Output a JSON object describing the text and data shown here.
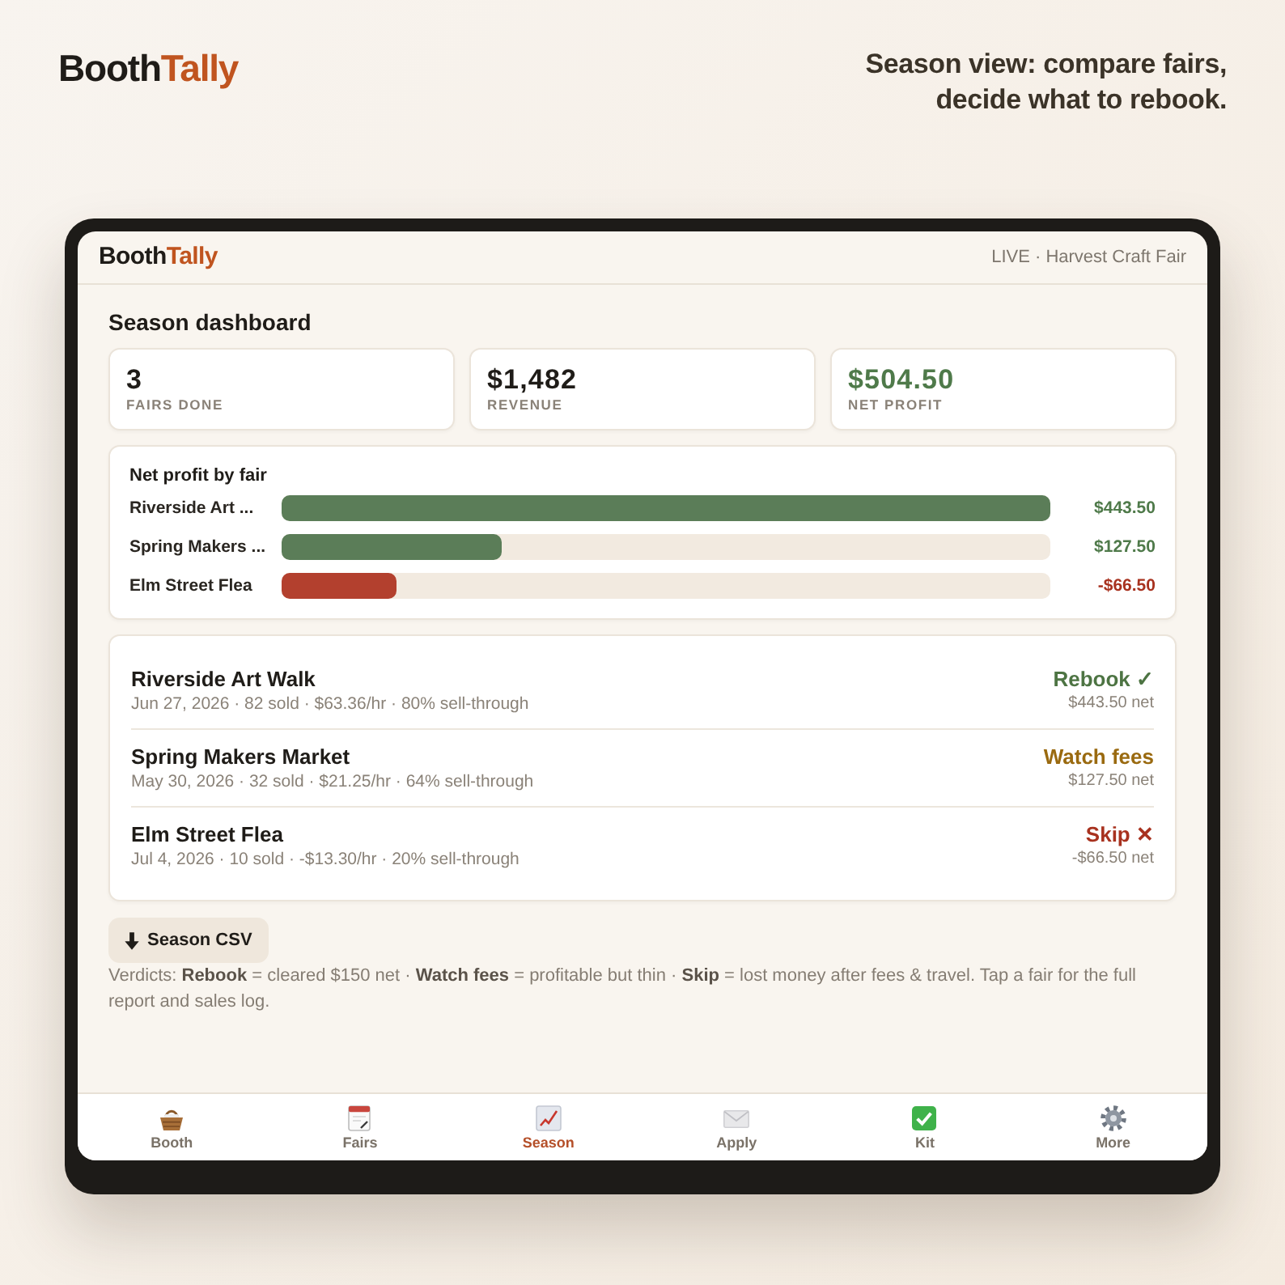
{
  "brand": {
    "name": "Booth",
    "accent": "Tally"
  },
  "tagline": [
    "Season view: compare fairs,",
    "decide what to rebook."
  ],
  "app_header": {
    "brand": {
      "name": "Booth",
      "accent": "Tally"
    },
    "status": "LIVE · Harvest Craft Fair"
  },
  "dashboard": {
    "title": "Season dashboard",
    "stats": [
      {
        "value": "3",
        "label": "FAIRS DONE",
        "kind": "neutral"
      },
      {
        "value": "$1,482",
        "label": "REVENUE",
        "kind": "neutral"
      },
      {
        "value": "$504.50",
        "label": "NET PROFIT",
        "kind": "positive"
      }
    ],
    "profit_chart": {
      "title": "Net profit by fair",
      "rows": [
        {
          "label": "Riverside Art ...",
          "level": 1,
          "value": "$443.50",
          "kind": "gain"
        },
        {
          "label": "Spring Makers ...",
          "level": 0.287,
          "value": "$127.50",
          "kind": "gain"
        },
        {
          "label": "Elm Street Flea",
          "level": 0.15,
          "value": "-$66.50",
          "kind": "loss"
        }
      ]
    },
    "fairs": [
      {
        "name": "Riverside Art Walk",
        "details": "Jun 27, 2026 · 82 sold · $63.36/hr · 80% sell-through",
        "verdict": "Rebook ✓",
        "kind": "rebook",
        "net": "$443.50 net"
      },
      {
        "name": "Spring Makers Market",
        "details": "May 30, 2026 · 32 sold · $21.25/hr · 64% sell-through",
        "verdict": "Watch fees",
        "kind": "watch",
        "net": "$127.50 net"
      },
      {
        "name": "Elm Street Flea",
        "details": "Jul 4, 2026 · 10 sold · -$13.30/hr · 20% sell-through",
        "verdict": "Skip ✕",
        "kind": "skip",
        "net": "-$66.50 net"
      }
    ],
    "export_button": "Season CSV",
    "legend": "Verdicts: **Rebook** = cleared $150 net · **Watch fees** = profitable but thin · **Skip** = lost money after fees & travel. Tap a fair for the full report and sales log."
  },
  "tab_bar": [
    {
      "label": "Booth",
      "selected": false
    },
    {
      "label": "Fairs",
      "selected": false
    },
    {
      "label": "Season",
      "selected": true
    },
    {
      "label": "Apply",
      "selected": false
    },
    {
      "label": "Kit",
      "selected": false
    },
    {
      "label": "More",
      "selected": false
    }
  ]
}
